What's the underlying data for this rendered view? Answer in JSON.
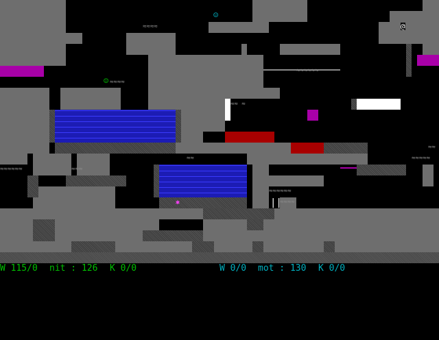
{
  "status": {
    "left_w": "W 115/0",
    "left_nit": "nit : 126",
    "left_k": "K 0/0",
    "right_w": "W 0/0",
    "right_mot": "mot : 130",
    "right_k": "K 0/0"
  },
  "colors": {
    "status_left": "#00c000",
    "status_right": "#00b0c0",
    "water": "#1c1cb4",
    "lava": "#a80000",
    "portal": "#a800a8",
    "rock": "#6e6e6e"
  },
  "glyphs": {
    "player_green": "☺",
    "player_cyan": "☺",
    "at_sign": "@",
    "spark": "✱",
    "bars": "||"
  },
  "icons": {
    "player_green": "smiley-icon",
    "player_cyan": "smiley-icon",
    "npc": "at-sign-icon",
    "spark": "asterisk-icon"
  }
}
